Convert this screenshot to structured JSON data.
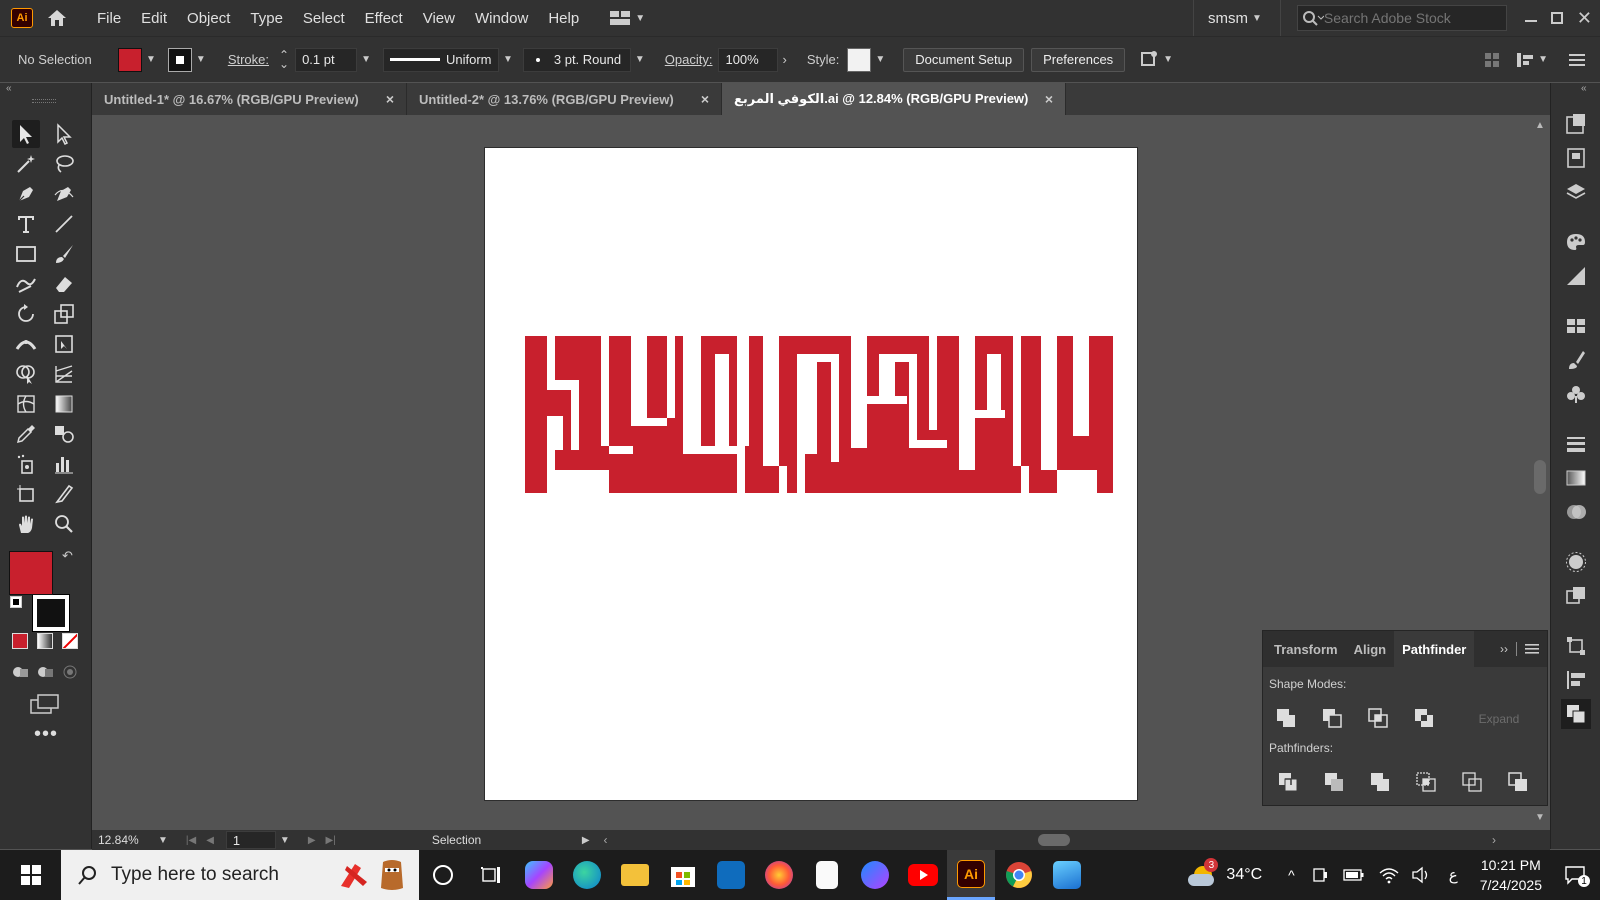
{
  "menubar": {
    "app_logo": "Ai",
    "items": [
      "File",
      "Edit",
      "Object",
      "Type",
      "Select",
      "Effect",
      "View",
      "Window",
      "Help"
    ],
    "workspace": "smsm",
    "search_placeholder": "Search Adobe Stock"
  },
  "control": {
    "selection_status": "No Selection",
    "fill_color": "#c8202d",
    "stroke_label": "Stroke:",
    "stroke_weight": "0.1 pt",
    "stroke_profile": "Uniform",
    "brush": "3 pt. Round",
    "opacity_label": "Opacity:",
    "opacity": "100%",
    "style_label": "Style:",
    "document_setup": "Document Setup",
    "preferences": "Preferences"
  },
  "tabs": [
    {
      "label": "Untitled-1* @ 16.67% (RGB/GPU Preview)",
      "close": "×"
    },
    {
      "label": "Untitled-2* @ 13.76% (RGB/GPU Preview)",
      "close": "×"
    },
    {
      "label": "الكوفي المربع.ai @ 12.84% (RGB/GPU Preview)",
      "close": "×"
    }
  ],
  "artwork": {
    "color": "#c8202d"
  },
  "pathfinder": {
    "tabs": [
      "Transform",
      "Align",
      "Pathfinder"
    ],
    "shape_modes_label": "Shape Modes:",
    "expand": "Expand",
    "pathfinders_label": "Pathfinders:"
  },
  "status": {
    "zoom": "12.84%",
    "artboard": "1",
    "mode": "Selection"
  },
  "taskbar": {
    "search": "Type here to search",
    "weather": "34°C",
    "weather_badge": "3",
    "lang": "ع",
    "time": "10:21 PM",
    "date": "7/24/2025",
    "notification_count": "1"
  }
}
